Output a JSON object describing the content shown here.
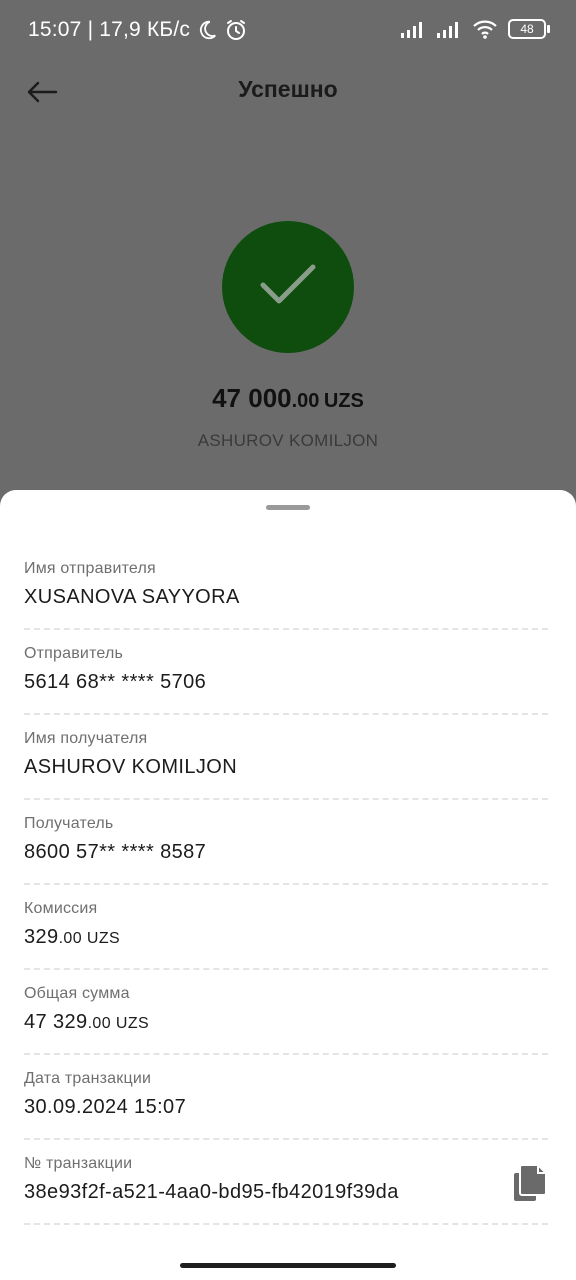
{
  "status": {
    "time": "15:07",
    "speed": "| 17,9 КБ/с",
    "battery": "48"
  },
  "header": {
    "title": "Успешно"
  },
  "summary": {
    "amount_int": "47 000",
    "amount_dec": ".00",
    "currency": "UZS",
    "recipient": "ASHUROV KOMILJON"
  },
  "details": {
    "sender_name_label": "Имя отправителя",
    "sender_name": "XUSANOVA SAYYORA",
    "sender_label": "Отправитель",
    "sender_card": "5614 68** **** 5706",
    "recipient_name_label": "Имя получателя",
    "recipient_name": "ASHUROV KOMILJON",
    "recipient_label": "Получатель",
    "recipient_card": "8600 57** **** 8587",
    "commission_label": "Комиссия",
    "commission_int": "329",
    "commission_dec": ".00 UZS",
    "total_label": "Общая сумма",
    "total_int": "47 329",
    "total_dec": ".00 UZS",
    "date_label": "Дата транзакции",
    "date": "30.09.2024 15:07",
    "txn_label": "№ транзакции",
    "txn_id": "38e93f2f-a521-4aa0-bd95-fb42019f39da"
  },
  "icons": {
    "back": "back-arrow-icon",
    "check": "checkmark-icon",
    "copy": "copy-icon"
  },
  "colors": {
    "success": "#0e4d0e",
    "overlay": "#6b6b6b"
  }
}
